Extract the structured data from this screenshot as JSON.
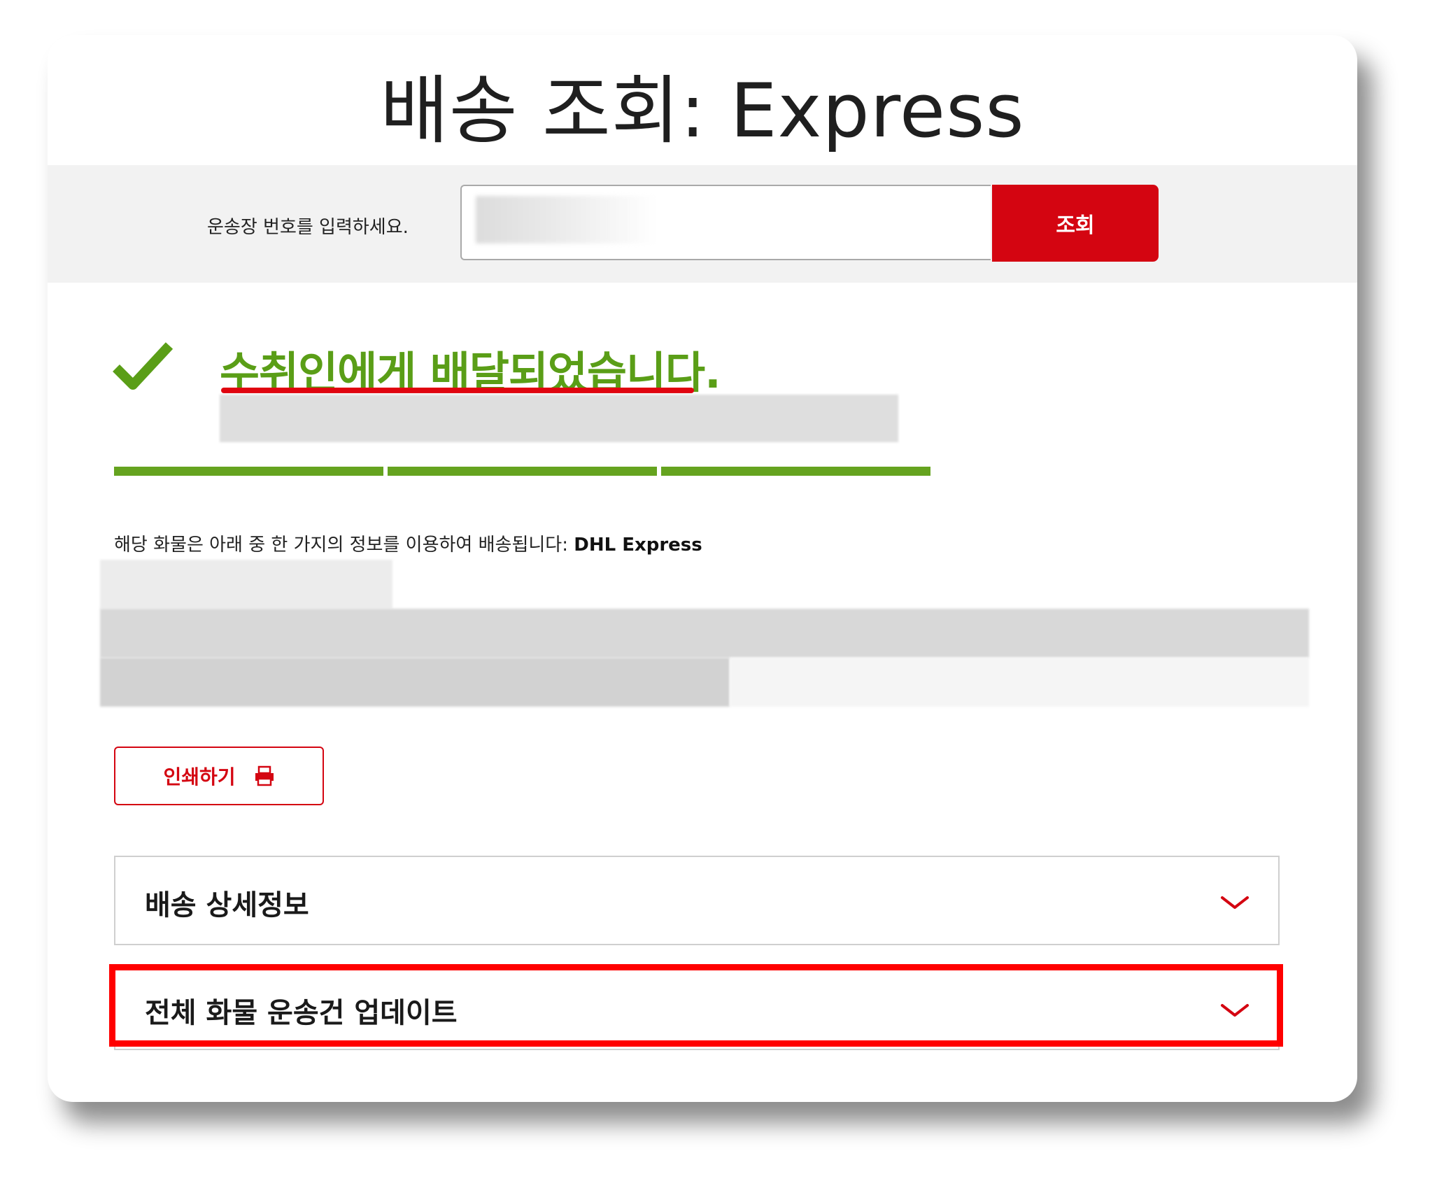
{
  "header": {
    "title": "배송 조회: Express"
  },
  "search": {
    "label": "운송장 번호를 입력하세요.",
    "input_value": "",
    "button_label": "조회"
  },
  "status": {
    "title": "수취인에게 배달되었습니다.",
    "progress_segments_filled": 3,
    "progress_segments_total": 3
  },
  "info": {
    "text": "해당 화물은 아래 중 한 가지의 정보를 이용하여 배송됩니다: ",
    "carrier": "DHL Express"
  },
  "actions": {
    "print_label": "인쇄하기"
  },
  "accordions": [
    {
      "label": "배송 상세정보"
    },
    {
      "label": "전체 화물 운송건 업데이트"
    }
  ],
  "colors": {
    "brand_red": "#d40511",
    "success_green": "#65a31f",
    "highlight_red": "#ff0000"
  }
}
